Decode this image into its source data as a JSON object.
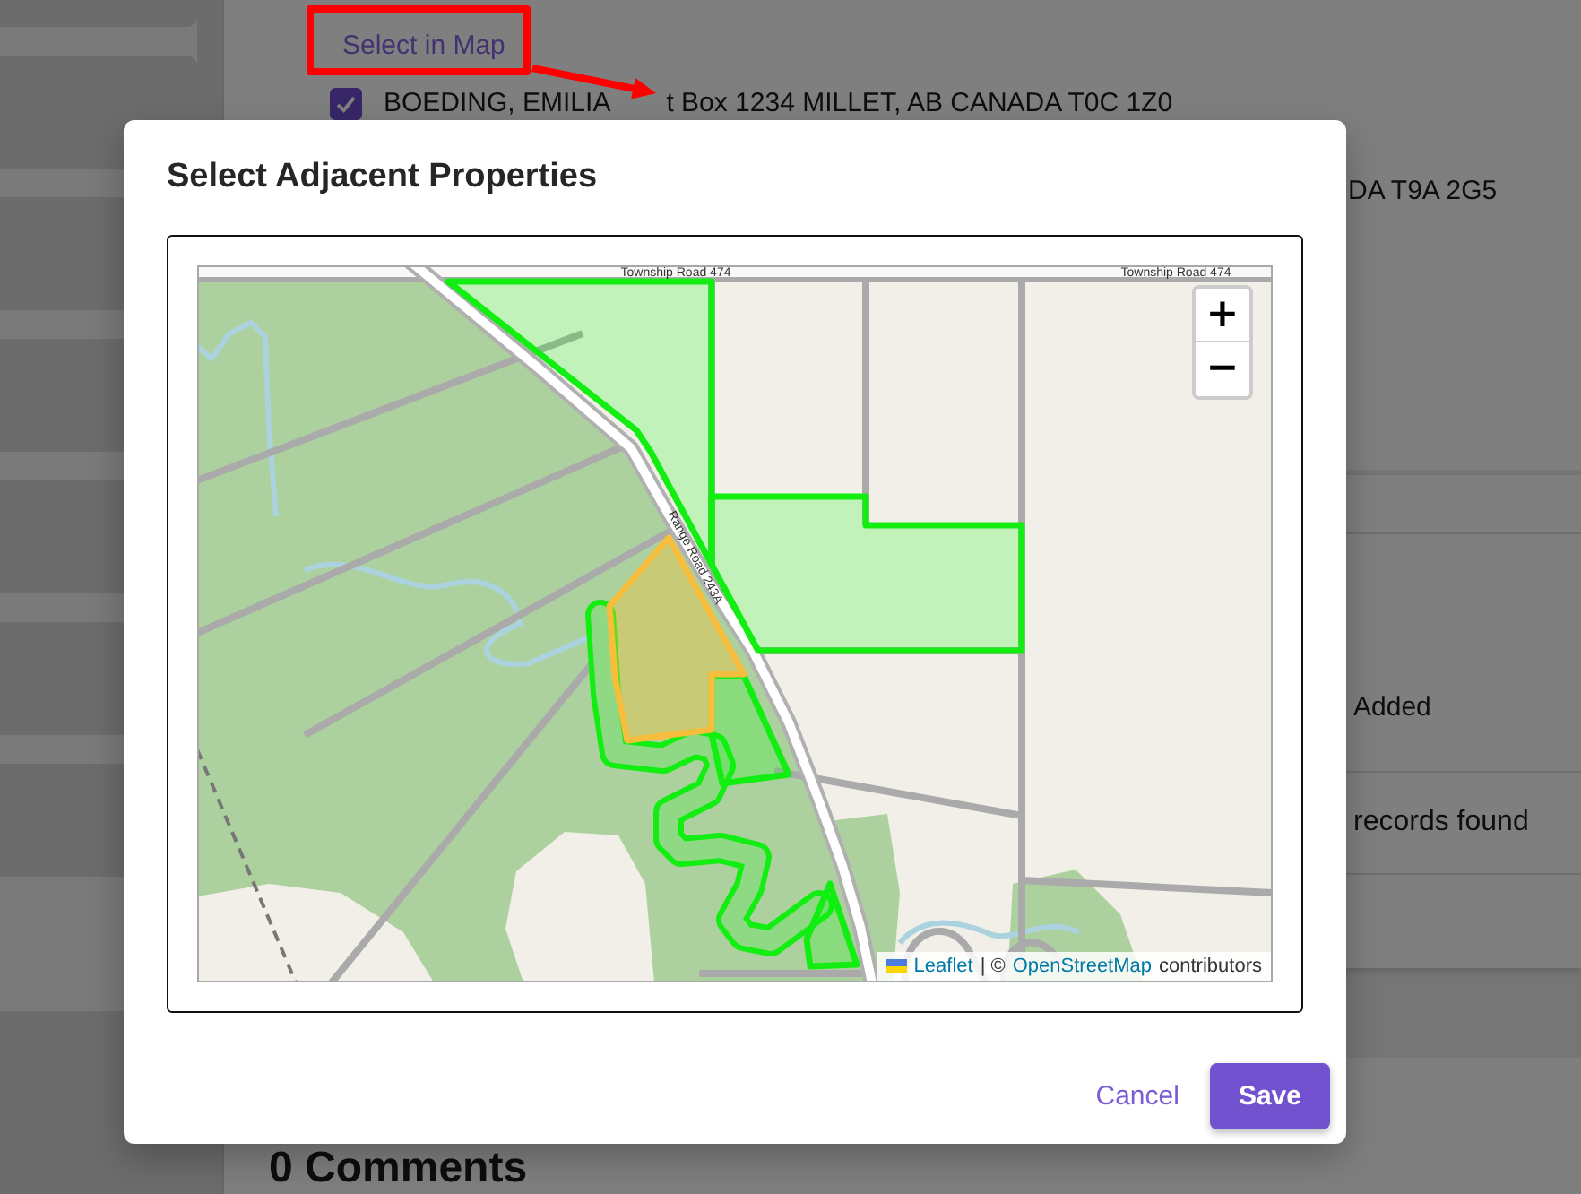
{
  "page": {
    "select_link": "Select in Map",
    "owner_row": {
      "checked": true,
      "name": "BOEDING, EMILIA",
      "address": "t Box 1234 MILLET, AB CANADA T0C 1Z0"
    },
    "address_fragment": "DA T9A 2G5",
    "table_header_fragment": "Added",
    "table_message_fragment": "records found",
    "comments_heading": "0 Comments"
  },
  "modal": {
    "title": "Select Adjacent Properties",
    "map": {
      "road_labels": [
        "Township Road 474",
        "Township Road 474",
        "Range Road 243A"
      ],
      "parcels": [
        {
          "kind": "adjacent",
          "selected": true
        },
        {
          "kind": "adjacent",
          "selected": true
        },
        {
          "kind": "adjacent",
          "selected": true
        },
        {
          "kind": "adjacent",
          "selected": true
        },
        {
          "kind": "adjacent",
          "selected": true
        },
        {
          "kind": "subject"
        }
      ],
      "zoom_in": "+",
      "zoom_out": "−",
      "attribution": [
        {
          "kind": "link",
          "text": "Leaflet"
        },
        {
          "kind": "text",
          "text": "| ©"
        },
        {
          "kind": "link",
          "text": "OpenStreetMap"
        },
        {
          "kind": "text",
          "text": "contributors"
        }
      ]
    },
    "buttons": [
      {
        "kind": "secondary",
        "label": "Cancel"
      },
      {
        "kind": "primary",
        "label": "Save"
      }
    ]
  }
}
